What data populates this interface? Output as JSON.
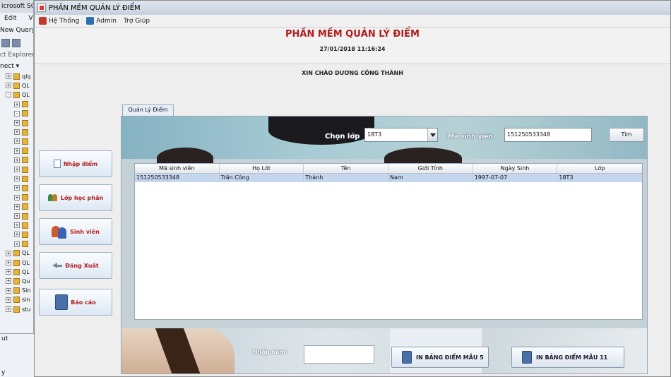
{
  "background_window": {
    "title": "icrosoft SQL",
    "menu": [
      "Edit",
      "Vi"
    ],
    "new_query": "New Query",
    "object_explorer": "ct Explorer",
    "connect": "nect ▾",
    "tree": [
      {
        "sign": "+",
        "label": "qlq"
      },
      {
        "sign": "+",
        "label": "QL"
      },
      {
        "sign": "-",
        "label": "QL"
      },
      {
        "sign": "+",
        "label": ""
      },
      {
        "sign": "-",
        "label": ""
      },
      {
        "sign": "+",
        "label": ""
      },
      {
        "sign": "+",
        "label": ""
      },
      {
        "sign": "+",
        "label": ""
      },
      {
        "sign": "+",
        "label": ""
      },
      {
        "sign": "+",
        "label": ""
      },
      {
        "sign": "+",
        "label": ""
      },
      {
        "sign": "+",
        "label": ""
      },
      {
        "sign": "+",
        "label": ""
      },
      {
        "sign": "+",
        "label": ""
      },
      {
        "sign": "+",
        "label": ""
      },
      {
        "sign": "+",
        "label": ""
      },
      {
        "sign": "+",
        "label": ""
      },
      {
        "sign": "+",
        "label": ""
      },
      {
        "sign": "+",
        "label": ""
      },
      {
        "sign": "+",
        "label": "QL"
      },
      {
        "sign": "+",
        "label": "QL"
      },
      {
        "sign": "+",
        "label": "QL"
      },
      {
        "sign": "+",
        "label": "Qu"
      },
      {
        "sign": "+",
        "label": "Sin"
      },
      {
        "sign": "+",
        "label": "sin"
      },
      {
        "sign": "+",
        "label": "stu"
      }
    ],
    "output": "ut",
    "status": "y"
  },
  "app": {
    "window_title": "PHẦN MỀM QUẢN LÝ ĐIỂM",
    "menu": [
      {
        "label": "Hệ Thống",
        "color": "#c0392b"
      },
      {
        "label": "Admin",
        "color": "#2d6fb5"
      },
      {
        "label": "Trợ Giúp",
        "color": ""
      }
    ],
    "title": "PHẦN MỀM QUẢN LÝ ĐIỂM",
    "datetime": "27/01/2018 11:16:24",
    "greeting": "XIN CHÀO DƯƠNG CÔNG THÀNH"
  },
  "nav": {
    "enter_scores": "Nhập điểm",
    "course_classes": "Lớp học phần",
    "students": "Sinh viên",
    "logout": "Đăng Xuất",
    "report": "Báo cáo"
  },
  "tab": {
    "label": "Quản Lý Điểm"
  },
  "filters": {
    "class_label": "Chọn lớp",
    "class_value": "18T3",
    "student_id_label": "Mã sinh viên",
    "student_id_value": "151250533348",
    "search_button": "Tìm"
  },
  "table": {
    "columns": [
      "Mã sinh viên",
      "Họ Lót",
      "Tên",
      "Giới Tính",
      "Ngày Sinh",
      "Lớp"
    ],
    "rows": [
      [
        "151250533348",
        "Trần Công",
        "Thành",
        "Nam",
        "1997-07-07",
        "18T3"
      ]
    ]
  },
  "footer": {
    "year_label": "Nhập năm:",
    "year_value": "",
    "print_5": "IN BẢNG ĐIỂM MẪU 5",
    "print_11": "IN BẢNG ĐIỂM MẪU 11"
  }
}
